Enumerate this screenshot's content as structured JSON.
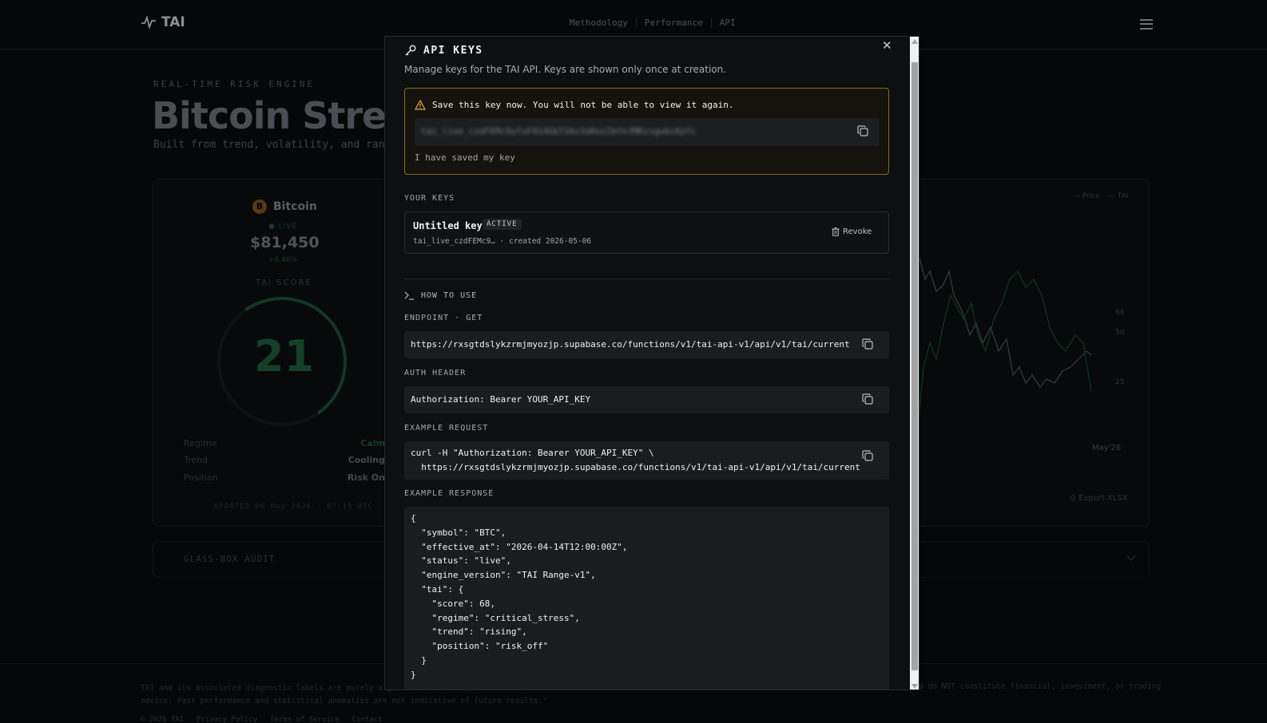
{
  "background": {
    "logo": "TAI",
    "nav": [
      "Methodology",
      "Performance",
      "API"
    ],
    "eyebrow": "REAL-TIME RISK ENGINE",
    "headline": "Bitcoin Stress",
    "subline": "Built from trend, volatility, and rang",
    "coin": {
      "icon": "B",
      "name": "Bitcoin",
      "live": "LIVE",
      "price": "$81,450",
      "change": "+0.40%"
    },
    "tai_label": "TAI SCORE",
    "tai_score": "21",
    "stats": [
      {
        "label": "Regime",
        "value": "Calm"
      },
      {
        "label": "Trend",
        "value": "Cooling"
      },
      {
        "label": "Position",
        "value": "Risk On"
      }
    ],
    "updated": "UPDATED 06 May 2026 · 07:19 UTC",
    "legend": [
      "Price",
      "TAI"
    ],
    "axis_ticks": [
      "68",
      "50",
      "25"
    ],
    "x_label": "May'26",
    "export": "Export XLSX",
    "audit": "GLASS-BOX AUDIT",
    "disclaimer_1": "TAI and its associated diagnostic labels are purely alg",
    "disclaimer_2": "advice. Past performance and statistical anomalies are not indicative of future results.\"",
    "disclaimer_right": "d do NOT constitute financial, investment, or trading",
    "footer_links": [
      "© 2026 TAI",
      "Privacy Policy",
      "Terms of Service",
      "Contact"
    ]
  },
  "modal": {
    "close": "✕",
    "title": "API KEYS",
    "subtitle": "Manage keys for the TAI API. Keys are shown only once at creation.",
    "warning": "Save this key now. You will not be able to view it again.",
    "new_key": "tai_live_czdFEMc9yfuF914GbT2Av3aRnzIbYnJMKcvgwbcKpfc",
    "saved_label": "I have saved my key",
    "your_keys_heading": "YOUR KEYS",
    "keys": [
      {
        "name": "Untitled key",
        "status": "ACTIVE",
        "meta": "tai_live_czdFEMc9… · created 2026-05-06",
        "action": "Revoke"
      }
    ],
    "how_to_heading": "HOW TO USE",
    "endpoint_heading": "ENDPOINT · GET",
    "endpoint": "https://rxsgtdslykzrmjmyozjp.supabase.co/functions/v1/tai-api-v1/api/v1/tai/current",
    "auth_heading": "AUTH HEADER",
    "auth": "Authorization: Bearer YOUR_API_KEY",
    "request_heading": "EXAMPLE REQUEST",
    "request": "curl -H \"Authorization: Bearer YOUR_API_KEY\" \\\n  https://rxsgtdslykzrmjmyozjp.supabase.co/functions/v1/tai-api-v1/api/v1/tai/current",
    "response_heading": "EXAMPLE RESPONSE",
    "response": "{\n  \"symbol\": \"BTC\",\n  \"effective_at\": \"2026-04-14T12:00:00Z\",\n  \"status\": \"live\",\n  \"engine_version\": \"TAI Range-v1\",\n  \"tai\": {\n    \"score\": 68,\n    \"regime\": \"critical_stress\",\n    \"trend\": \"rising\",\n    \"position\": \"risk_off\"\n  }\n}"
  },
  "colors": {
    "accent_green": "#1c4a30",
    "warning_border": "#8a6a1d",
    "warning_icon": "#e3a52b"
  }
}
